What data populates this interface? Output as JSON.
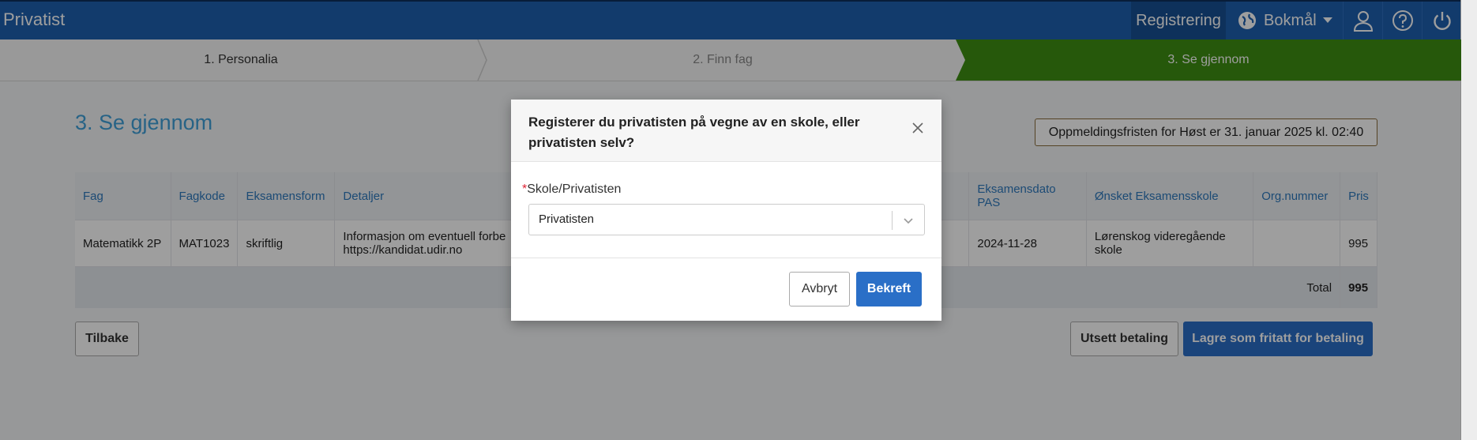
{
  "app": {
    "title": "Privatist"
  },
  "topbar": {
    "register_label": "Registrering",
    "language_label": "Bokmål",
    "icons": [
      "globe-icon",
      "user-icon",
      "help-icon",
      "power-icon"
    ]
  },
  "steps": [
    {
      "label": "1. Personalia",
      "state": "done"
    },
    {
      "label": "2. Finn fag",
      "state": "inactive"
    },
    {
      "label": "3. Se gjennom",
      "state": "active"
    }
  ],
  "page": {
    "heading": "3. Se gjennom",
    "deadline_notice": "Oppmeldingsfristen for Høst er 31. januar 2025 kl. 02:40"
  },
  "table": {
    "headers": [
      "Fag",
      "Fagkode",
      "Eksamensform",
      "Detaljer",
      "Eksamensdato PAS",
      "Ønsket Eksamensskole",
      "Org.nummer",
      "Pris"
    ],
    "row": {
      "fag": "Matematikk 2P",
      "fagkode": "MAT1023",
      "eksamensform": "skriftlig",
      "detaljer_line1": "Informasjon om eventuell forbe",
      "detaljer_line2": "https://kandidat.udir.no",
      "eksamensdato": "2024-11-28",
      "skole": "Lørenskog videregående skole",
      "orgnummer": "",
      "pris": "995"
    },
    "total_label": "Total",
    "total_value": "995"
  },
  "buttons": {
    "back": "Tilbake",
    "postpone": "Utsett betaling",
    "save_exempt": "Lagre som fritatt for betaling"
  },
  "modal": {
    "title": "Registerer du privatisten på vegne av en skole, eller privatisten selv?",
    "required_marker": "*",
    "field_label": "Skole/Privatisten",
    "field_value": "Privatisten",
    "cancel": "Avbryt",
    "confirm": "Bekreft"
  },
  "colors": {
    "topbar": "#1d5fae",
    "active_step": "#3e8f12",
    "heading": "#3fa0d9",
    "primary_button": "#2a6fc7"
  }
}
